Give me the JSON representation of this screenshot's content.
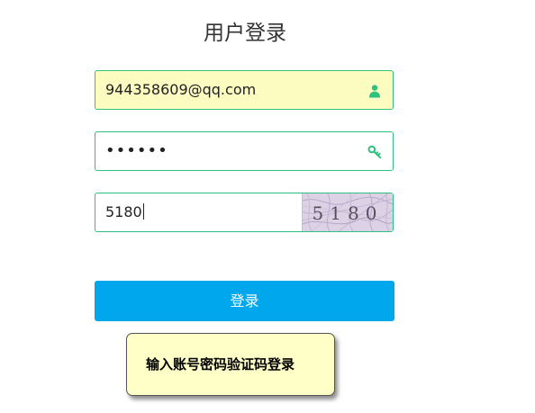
{
  "page": {
    "title": "用户登录"
  },
  "form": {
    "username": {
      "value": "944358609@qq.com",
      "icon": "user-icon"
    },
    "password": {
      "masked_value": "••••••",
      "icon": "key-icon"
    },
    "captcha": {
      "value": "5180",
      "image_text": "5180"
    },
    "login_label": "登录"
  },
  "tooltip": {
    "text": "输入账号密码验证码登录"
  },
  "colors": {
    "accent_green": "#2ec27e",
    "button_blue": "#00a7ec",
    "autofill_yellow": "#fcfcc0",
    "tooltip_bg": "#ffffc8"
  }
}
